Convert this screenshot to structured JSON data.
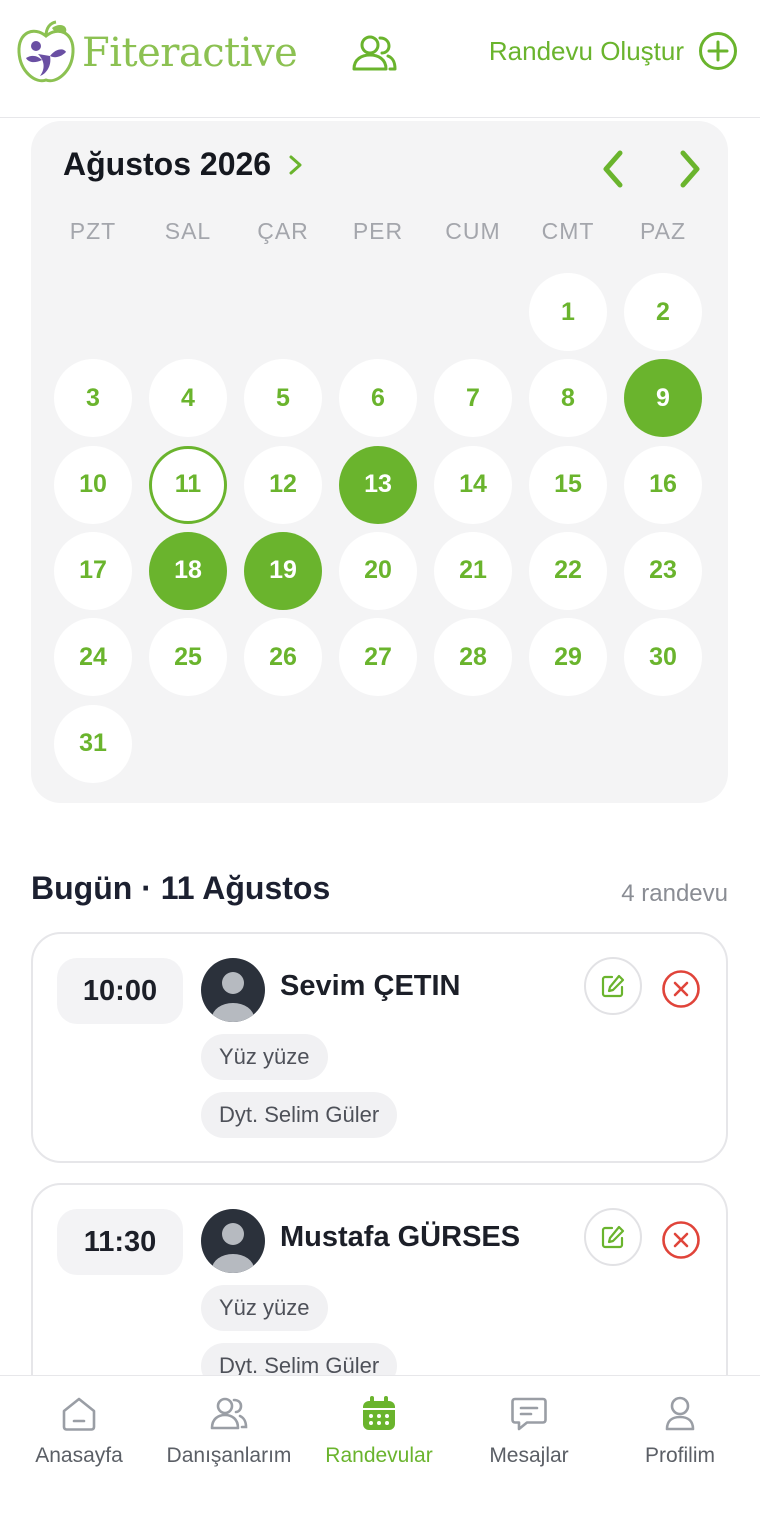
{
  "header": {
    "logo_text": "Fiteractive",
    "create_label": "Randevu Oluştur"
  },
  "calendar": {
    "month_label": "Ağustos 2026",
    "weekdays": [
      "PZT",
      "SAL",
      "ÇAR",
      "PER",
      "CUM",
      "CMT",
      "PAZ"
    ],
    "days": [
      "1",
      "2",
      "3",
      "4",
      "5",
      "6",
      "7",
      "8",
      "9",
      "10",
      "11",
      "12",
      "13",
      "14",
      "15",
      "16",
      "17",
      "18",
      "19",
      "20",
      "21",
      "22",
      "23",
      "24",
      "25",
      "26",
      "27",
      "28",
      "29",
      "30",
      "31"
    ],
    "first_weekday_index": 5,
    "highlighted_days": [
      9,
      13,
      18,
      19
    ],
    "today": 11
  },
  "today_section": {
    "title": "Bugün · 11 Ağustos",
    "count": "4 randevu"
  },
  "appointments": [
    {
      "time": "10:00",
      "name": "Sevim ÇETIN",
      "type": "Yüz yüze",
      "dietitian": "Dyt. Selim Güler"
    },
    {
      "time": "11:30",
      "name": "Mustafa GÜRSES",
      "type": "Yüz yüze",
      "dietitian": "Dyt. Selim Güler"
    }
  ],
  "tabs": [
    {
      "label": "Anasayfa",
      "icon": "home-icon"
    },
    {
      "label": "Danışanlarım",
      "icon": "clients-icon"
    },
    {
      "label": "Randevular",
      "icon": "calendar-icon"
    },
    {
      "label": "Mesajlar",
      "icon": "messages-icon"
    },
    {
      "label": "Profilim",
      "icon": "profile-icon"
    }
  ],
  "colors": {
    "accent": "#6ab42d",
    "logo_green": "#8cc152",
    "logo_purple": "#6a4fa3",
    "danger": "#e0443a",
    "calendar_bg": "#f4f4f5"
  }
}
